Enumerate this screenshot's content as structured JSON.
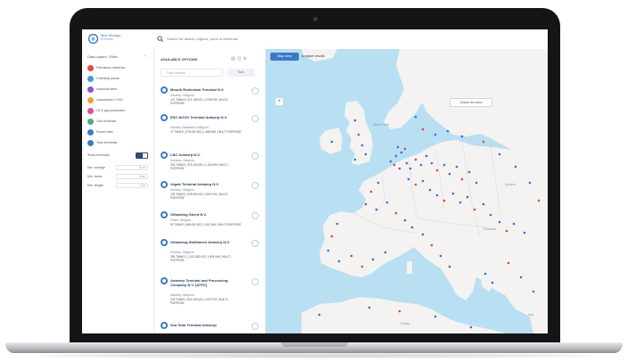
{
  "app": {
    "logo_line1": "Tank Storage",
    "logo_line2": "Terminals"
  },
  "search": {
    "placeholder": "Search for assets, regions, ports or terminals"
  },
  "sidebar": {
    "title": "Data Layers / Filter",
    "items": [
      {
        "label": "Petroleum refineries",
        "color": "#e84a4a"
      },
      {
        "label": "Chemical plants",
        "color": "#3d9be0"
      },
      {
        "label": "Industrial sites",
        "color": "#8e55c9"
      },
      {
        "label": "Liquefaction / LNG",
        "color": "#f2a13a"
      },
      {
        "label": "Oil & gas production",
        "color": "#e84a9a"
      },
      {
        "label": "Gas terminals",
        "color": "#44b06a"
      },
      {
        "label": "Power sites",
        "color": "#3d78c9"
      },
      {
        "label": "Tank terminals",
        "color": "#3d78c9"
      }
    ],
    "toggle_label": "Show terminals",
    "fields": [
      {
        "label": "Min. storage",
        "value": "0 m³"
      },
      {
        "label": "Min. tanks",
        "value": "0 m³"
      },
      {
        "label": "Min. length",
        "value": "0 m"
      }
    ]
  },
  "list_panel": {
    "title": "AVAILABLE OPTIONS",
    "filter_placeholder": "Filter options",
    "sort_label": "Sort",
    "cards": [
      {
        "name": "Mourik Rotterdam Terminal N.V.",
        "location": "Antwerp, Belgium",
        "meta": "147 TANKS | 571.198 M3 | 3.095 PM | MULTI-PURPOSE"
      },
      {
        "name": "ESC NOVO Terminal Antwerp N.V.",
        "location": "Antwerp-Waasland, Belgium",
        "meta": "47 TANKS | 278.000 M3 | 1.468 MM | MULTI-PURPOSE"
      },
      {
        "name": "LBC Antwerp N.V.",
        "location": "Antwerp, Belgium",
        "meta": "218 TANKS | 574.000 M3 | 1.126 MM | MULTI-PURPOSE"
      },
      {
        "name": "Vopak Terminal Antwerp N.V.",
        "location": "Antwerp, Belgium",
        "meta": "125 TANKS | 678.000 M3 | 3.813 PM | MULTI-PURPOSE"
      },
      {
        "name": "Oiltanking Ghent N.V.",
        "location": "Ghent, Belgium",
        "meta": "82 TANKS | 568.000 M3 | 1.001 MM | MULTI-PURPOSE"
      },
      {
        "name": "Oiltanking Stolthaven Antwerp N.V.",
        "location": "Antwerp, Belgium",
        "meta": "289 TANKS | 1.031.000 M3 | 1.600 MM | MULTI-PURPOSE"
      },
      {
        "name": "Antwerp Terminal and Processing Company N.V. (ATPC)",
        "location": "Antwerp, Belgium",
        "meta": "118 TANKS | 923.000 M3 | 4.037 PM | MULTI-PURPOSE"
      },
      {
        "name": "Sea Tank Terminal Antwerp",
        "location": "Antwerp, Belgium",
        "meta": ""
      }
    ]
  },
  "map": {
    "tab_map": "Map view",
    "tab_analyze": "Analyze results",
    "zoom_label": "+",
    "area_button": "Search this area",
    "labels": {
      "north_sea": "North Sea",
      "ukraine": "Ukraine",
      "romania": "Romania",
      "iraq": "Iraq",
      "tunisia": "Tunisia"
    }
  },
  "colors": {
    "accent": "#3d78c9",
    "water": "#b9dff2",
    "land": "#f4f3f1",
    "marker_blue": "#3d6fd6",
    "marker_red": "#e0453e"
  }
}
